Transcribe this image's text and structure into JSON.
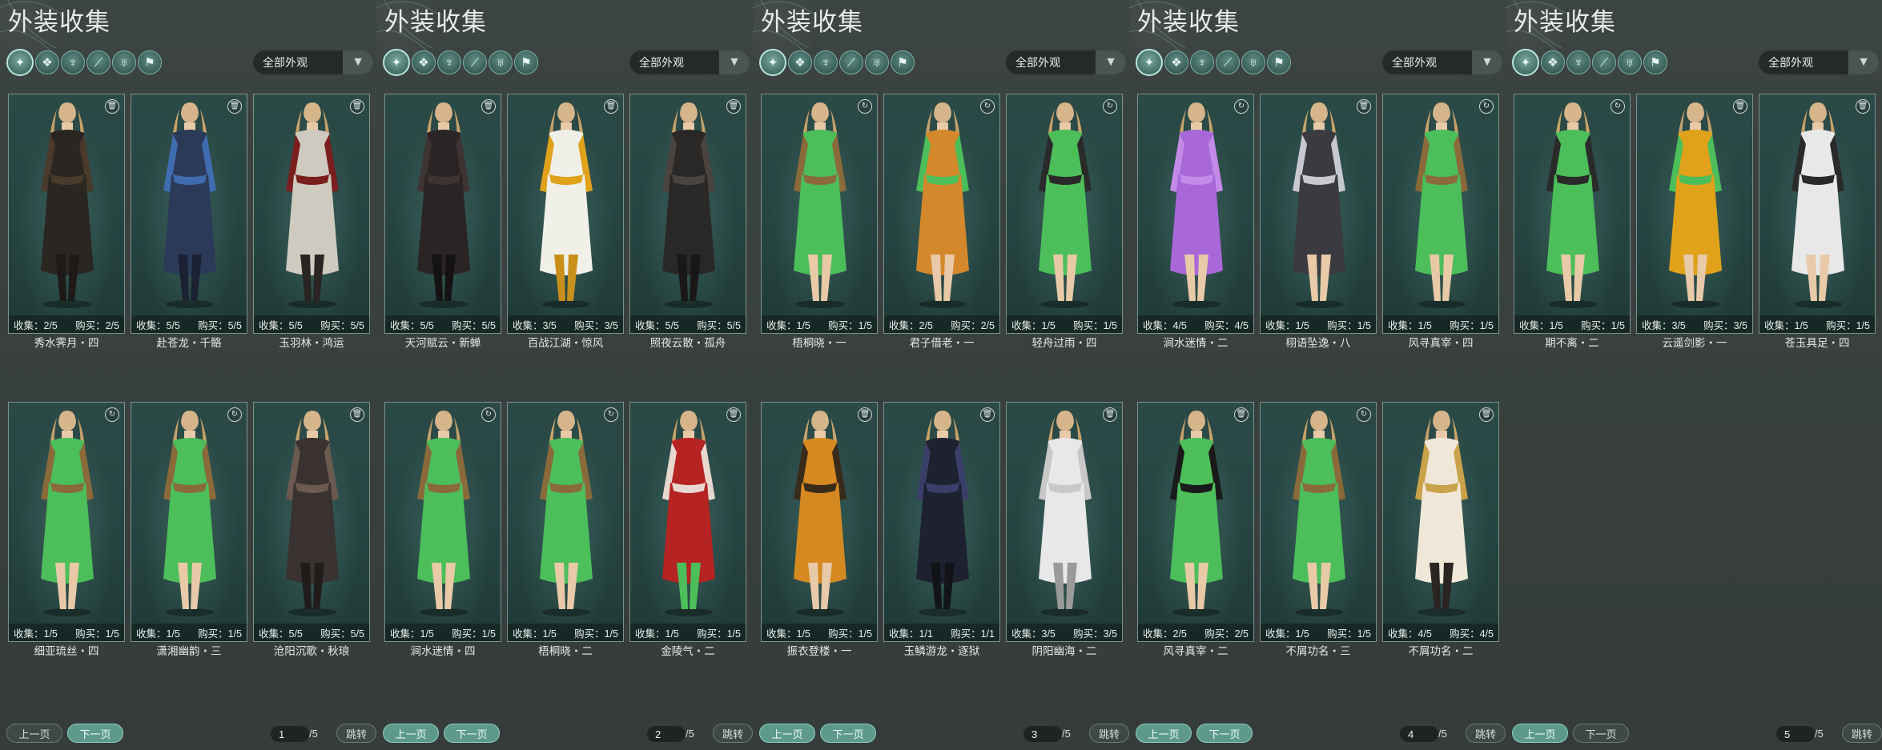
{
  "panels": [
    {
      "title": "外装收集",
      "dropdown": "全部外观",
      "page": "1",
      "total": "/5",
      "prev": "上一页",
      "next": "下一页",
      "jump": "跳转",
      "prev_enabled": false,
      "next_enabled": true,
      "cards": [
        {
          "name": "秀水霁月・四",
          "collect": "收集：2/5",
          "buy": "购买：2/5",
          "corner": "trash",
          "palette": [
            "#2a2622",
            "#4a3a2c",
            "#1d1a17"
          ]
        },
        {
          "name": "赴苍龙・千骼",
          "collect": "收集：5/5",
          "buy": "购买：5/5",
          "corner": "trash",
          "palette": [
            "#2c3a5a",
            "#3f6cae",
            "#1c2234"
          ]
        },
        {
          "name": "玉羽林・鸿运",
          "collect": "收集：5/5",
          "buy": "购买：5/5",
          "corner": "trash",
          "palette": [
            "#cfcac0",
            "#7a1e1e",
            "#2a2422"
          ]
        },
        {
          "name": "细亚琉丝・四",
          "collect": "收集：1/5",
          "buy": "购买：1/5",
          "corner": "cycle",
          "palette": [
            "#4cbe5a",
            "#8a6a3a",
            "#e8c9a8"
          ]
        },
        {
          "name": "潇湘幽韵・三",
          "collect": "收集：1/5",
          "buy": "购买：1/5",
          "corner": "cycle",
          "palette": [
            "#4cbe5a",
            "#8a6a3a",
            "#e8c9a8"
          ]
        },
        {
          "name": "沧阳沉歌・秋琅",
          "collect": "收集：5/5",
          "buy": "购买：5/5",
          "corner": "trash",
          "palette": [
            "#3a3230",
            "#6a5a50",
            "#211c1a"
          ]
        }
      ]
    },
    {
      "title": "外装收集",
      "dropdown": "全部外观",
      "page": "2",
      "total": "/5",
      "prev": "上一页",
      "next": "下一页",
      "jump": "跳转",
      "prev_enabled": true,
      "next_enabled": true,
      "cards": [
        {
          "name": "天河赋云・新蝉",
          "collect": "收集：5/5",
          "buy": "购买：5/5",
          "corner": "trash",
          "palette": [
            "#2a2424",
            "#3e3434",
            "#141212"
          ]
        },
        {
          "name": "百战江湖・惊风",
          "collect": "收集：3/5",
          "buy": "购买：3/5",
          "corner": "trash",
          "palette": [
            "#f0f0e8",
            "#e0a21a",
            "#c8901a"
          ]
        },
        {
          "name": "照夜云散・孤舟",
          "collect": "收集：5/5",
          "buy": "购买：5/5",
          "corner": "trash",
          "palette": [
            "#2a2826",
            "#4a4440",
            "#1a1816"
          ]
        },
        {
          "name": "涧水迷情・四",
          "collect": "收集：1/5",
          "buy": "购买：1/5",
          "corner": "cycle",
          "palette": [
            "#4cbe5a",
            "#8a6a3a",
            "#e8c9a8"
          ]
        },
        {
          "name": "梧桐晓・二",
          "collect": "收集：1/5",
          "buy": "购买：1/5",
          "corner": "cycle",
          "palette": [
            "#4cbe5a",
            "#8a6a3a",
            "#e8c9a8"
          ]
        },
        {
          "name": "金陵气・二",
          "collect": "收集：1/5",
          "buy": "购买：1/5",
          "corner": "trash",
          "palette": [
            "#b52323",
            "#e8d8d0",
            "#4cbe5a"
          ]
        }
      ]
    },
    {
      "title": "外装收集",
      "dropdown": "全部外观",
      "page": "3",
      "total": "/5",
      "prev": "上一页",
      "next": "下一页",
      "jump": "跳转",
      "prev_enabled": true,
      "next_enabled": true,
      "cards": [
        {
          "name": "梧桐晓・一",
          "collect": "收集：1/5",
          "buy": "购买：1/5",
          "corner": "cycle",
          "palette": [
            "#4cbe5a",
            "#8a6a3a",
            "#e8c9a8"
          ]
        },
        {
          "name": "君子借老・一",
          "collect": "收集：2/5",
          "buy": "购买：2/5",
          "corner": "cycle",
          "palette": [
            "#d4882c",
            "#4cbe5a",
            "#e8c9a8"
          ]
        },
        {
          "name": "轻舟过雨・四",
          "collect": "收集：1/5",
          "buy": "购买：1/5",
          "corner": "cycle",
          "palette": [
            "#4cbe5a",
            "#2a2a2a",
            "#e8c9a8"
          ]
        },
        {
          "name": "振衣登楼・一",
          "collect": "收集：1/5",
          "buy": "购买：1/5",
          "corner": "trash",
          "palette": [
            "#d48a20",
            "#3a2a1a",
            "#e8c9a8"
          ]
        },
        {
          "name": "玉鳞游龙・逐狱",
          "collect": "收集：1/1",
          "buy": "购买：1/1",
          "corner": "trash",
          "palette": [
            "#1e2230",
            "#3a3f6a",
            "#121418"
          ]
        },
        {
          "name": "阴阳幽海・二",
          "collect": "收集：3/5",
          "buy": "购买：3/5",
          "corner": "trash",
          "palette": [
            "#e8e8e8",
            "#c8c8c8",
            "#9a9a9a"
          ]
        }
      ]
    },
    {
      "title": "外装收集",
      "dropdown": "全部外观",
      "page": "4",
      "total": "/5",
      "prev": "上一页",
      "next": "下一页",
      "jump": "跳转",
      "prev_enabled": true,
      "next_enabled": true,
      "cards": [
        {
          "name": "涧水迷情・二",
          "collect": "收集：4/5",
          "buy": "购买：4/5",
          "corner": "cycle",
          "palette": [
            "#a868d8",
            "#c48ae8",
            "#e8c9a8"
          ]
        },
        {
          "name": "栩语坠逸・八",
          "collect": "收集：1/5",
          "buy": "购买：1/5",
          "corner": "trash",
          "palette": [
            "#3a3a40",
            "#c8c8d0",
            "#e8c9a8"
          ]
        },
        {
          "name": "风寻真宰・四",
          "collect": "收集：1/5",
          "buy": "购买：1/5",
          "corner": "cycle",
          "palette": [
            "#4cbe5a",
            "#8a6a3a",
            "#e8c9a8"
          ]
        },
        {
          "name": "风寻真宰・二",
          "collect": "收集：2/5",
          "buy": "购买：2/5",
          "corner": "trash",
          "palette": [
            "#4cbe5a",
            "#1a1a1a",
            "#e8c9a8"
          ]
        },
        {
          "name": "不屑功名・三",
          "collect": "收集：1/5",
          "buy": "购买：1/5",
          "corner": "cycle",
          "palette": [
            "#4cbe5a",
            "#8a6a3a",
            "#e8c9a8"
          ]
        },
        {
          "name": "不屑功名・二",
          "collect": "收集：4/5",
          "buy": "购买：4/5",
          "corner": "trash",
          "palette": [
            "#efe8d8",
            "#c9a24a",
            "#2a2422"
          ]
        }
      ]
    },
    {
      "title": "外装收集",
      "dropdown": "全部外观",
      "page": "5",
      "total": "/5",
      "prev": "上一页",
      "next": "下一页",
      "jump": "跳转",
      "prev_enabled": true,
      "next_enabled": false,
      "cards": [
        {
          "name": "期不离・二",
          "collect": "收集：1/5",
          "buy": "购买：1/5",
          "corner": "cycle",
          "palette": [
            "#4cbe5a",
            "#2a2a2a",
            "#e8c9a8"
          ]
        },
        {
          "name": "云遥剑影・一",
          "collect": "收集：3/5",
          "buy": "购买：3/5",
          "corner": "trash",
          "palette": [
            "#e0a21a",
            "#4cbe5a",
            "#e8c9a8"
          ]
        },
        {
          "name": "苍玉具足・四",
          "collect": "收集：1/5",
          "buy": "购买：1/5",
          "corner": "trash",
          "palette": [
            "#e8e8e8",
            "#2a2a2a",
            "#e8c9a8"
          ]
        }
      ]
    }
  ],
  "filter_icons": [
    "outfit-all-icon",
    "upper-garment-icon",
    "cloak-icon",
    "weapon-icon",
    "mask-icon",
    "accessory-icon"
  ]
}
